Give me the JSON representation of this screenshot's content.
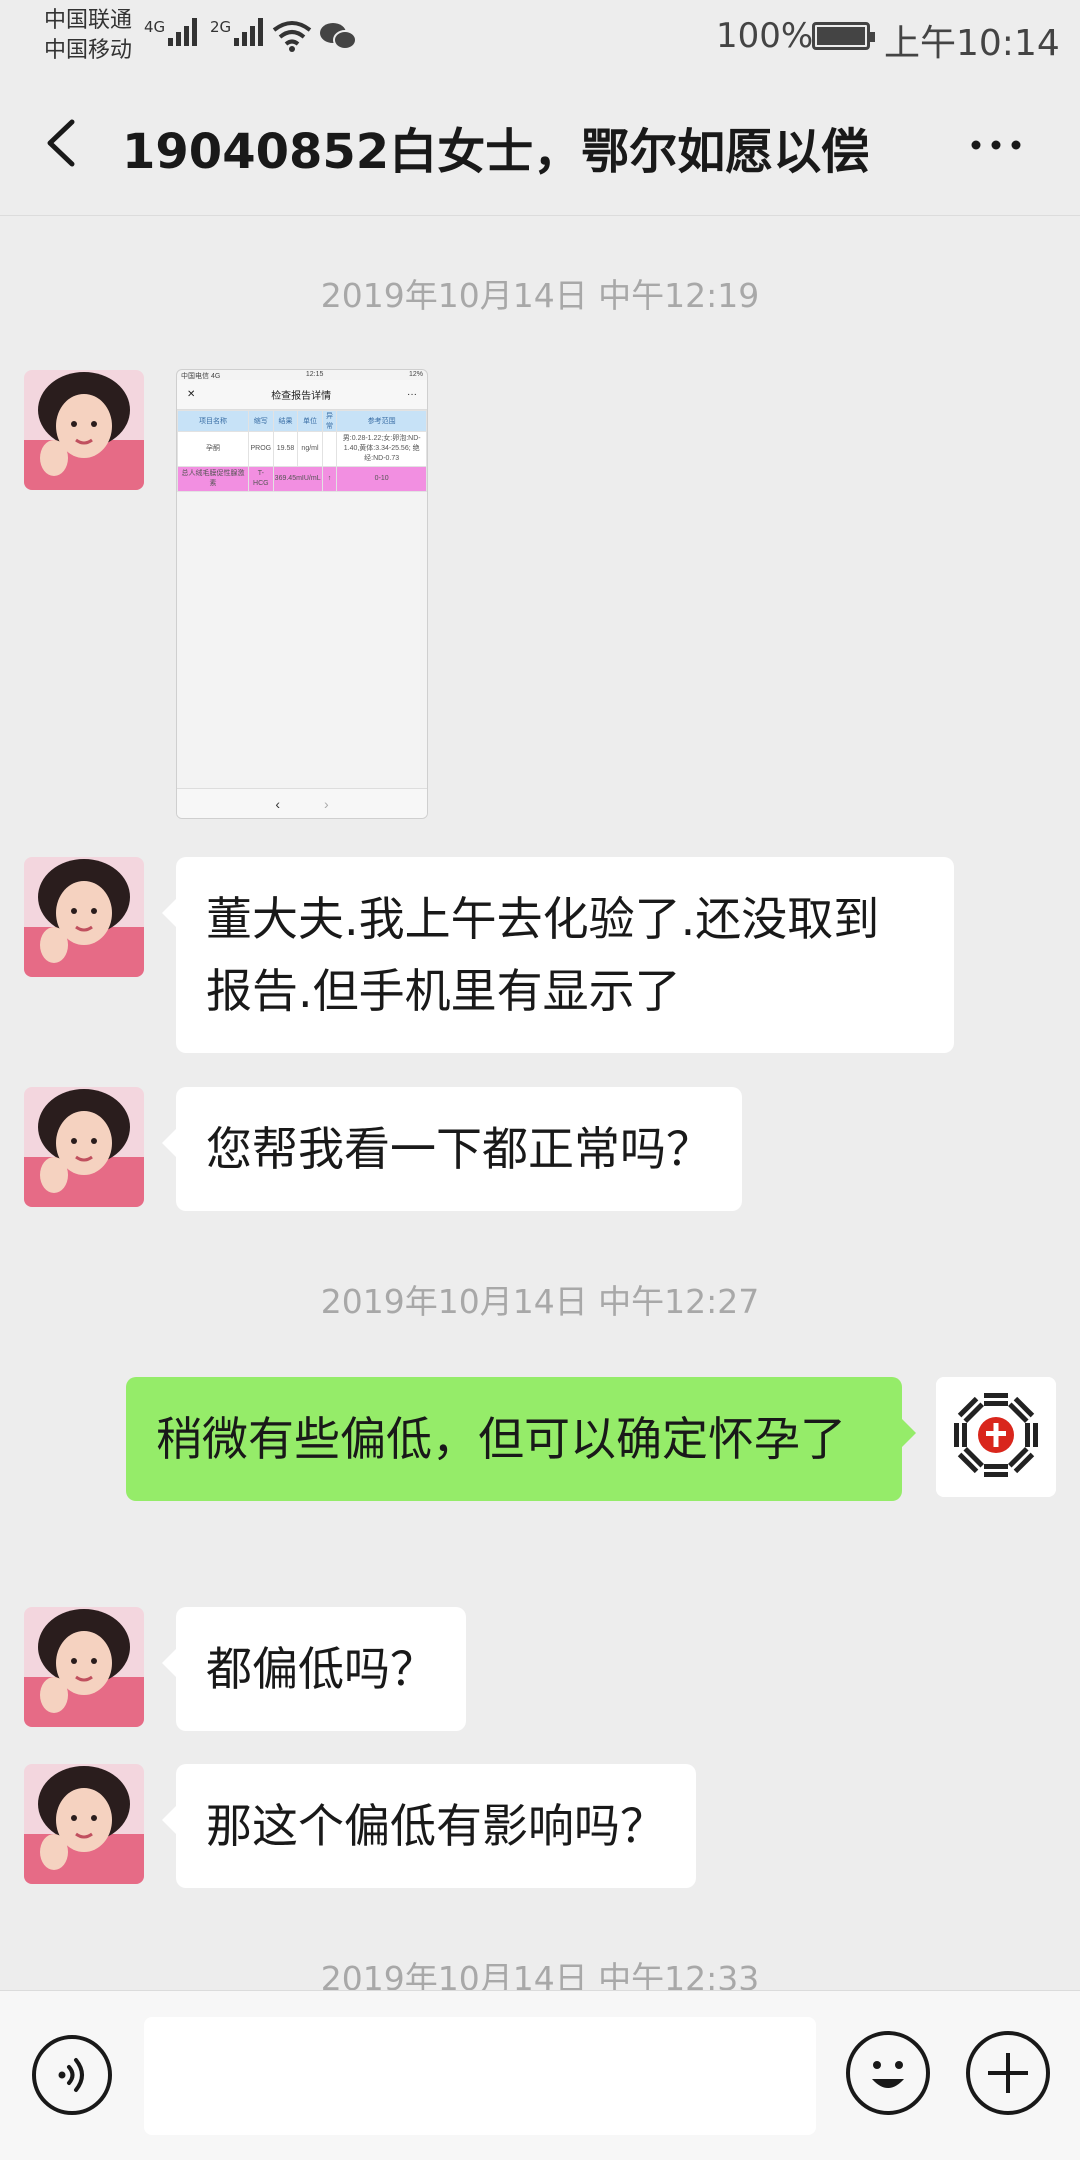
{
  "status_bar": {
    "carrier_1": "中国联通",
    "carrier_2": "中国移动",
    "net_1": "4G",
    "net_2": "2G",
    "battery": "100%",
    "time": "上午10:14"
  },
  "header": {
    "title": "19040852白女士，鄂尔如愿以偿",
    "back_icon": "chevron-left-icon",
    "more_icon": "ellipsis-icon"
  },
  "messages": {
    "ts1": "2019年10月14日 中午12:19",
    "image_msg": {
      "statusbar_left": "中国电信 4G",
      "statusbar_time": "12:15",
      "statusbar_right": "12%",
      "nav_close": "✕",
      "nav_title": "检查报告详情",
      "nav_more": "···",
      "columns": [
        "项目名称",
        "缩写",
        "结果",
        "单位",
        "异常",
        "参考范围"
      ],
      "row1": [
        "孕酮",
        "PROG",
        "19.58",
        "ng/ml",
        "",
        "男:0.28-1.22;女:卵泡:ND-1.40,黄体:3.34-25.56; 绝经:ND-0.73"
      ],
      "row2": [
        "总人绒毛膜促性腺激素",
        "T-HCG",
        "369.45mIU/mL",
        "↑",
        "",
        "0-10"
      ],
      "footer_prev": "‹",
      "footer_next": "›"
    },
    "m1": "董大夫.我上午去化验了.还没取到报告.但手机里有显示了",
    "m2": "您帮我看一下都正常吗？",
    "ts2": "2019年10月14日 中午12:27",
    "m3": "稍微有些偏低，但可以确定怀孕了",
    "m4": "都偏低吗？",
    "m5": "那这个偏低有影响吗？",
    "ts3": "2019年10月14日 中午12:33"
  },
  "input_bar": {
    "voice_icon": "voice-icon",
    "emoji_icon": "emoji-icon",
    "plus_icon": "plus-icon",
    "placeholder": ""
  },
  "colors": {
    "background": "#ededed",
    "incoming_bubble": "#ffffff",
    "outgoing_bubble": "#95ec69",
    "timestamp": "#a8a8a8",
    "highlight_row": "#f28fe1",
    "table_header": "#c7e2f7",
    "logo_red": "#d9261c"
  }
}
